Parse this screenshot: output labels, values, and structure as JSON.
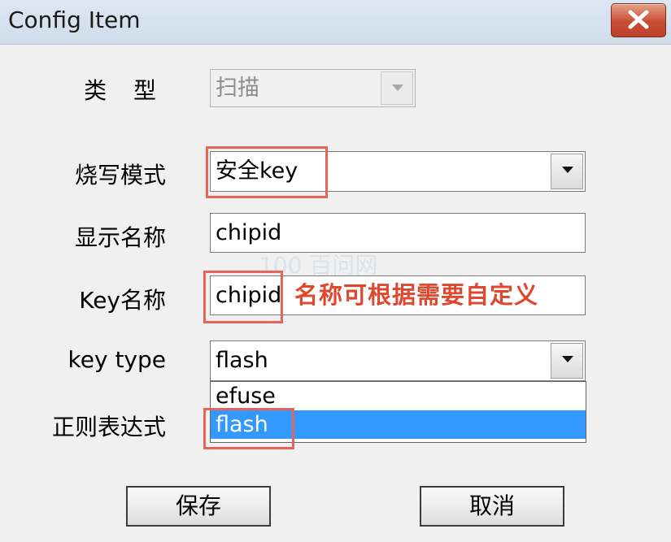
{
  "window": {
    "title": "Config Item"
  },
  "form": {
    "type_label": "类 型",
    "type_value": "扫描",
    "burn_mode_label": "烧写模式",
    "burn_mode_value": "安全key",
    "display_name_label": "显示名称",
    "display_name_value": "chipid",
    "key_name_label": "Key名称",
    "key_name_value": "chipid",
    "key_type_label": "key type",
    "key_type_value": "flash",
    "key_type_options": [
      "efuse",
      "flash"
    ],
    "regex_label": "正则表达式"
  },
  "annotation": {
    "text": "名称可根据需要自定义",
    "color": "#e0472f"
  },
  "watermark": "100 百问网",
  "buttons": {
    "save_label": "保存",
    "cancel_label": "取消"
  },
  "colors": {
    "selection": "#3399ff",
    "annotation_box": "#e4665a",
    "close_button": "#c74d32"
  }
}
